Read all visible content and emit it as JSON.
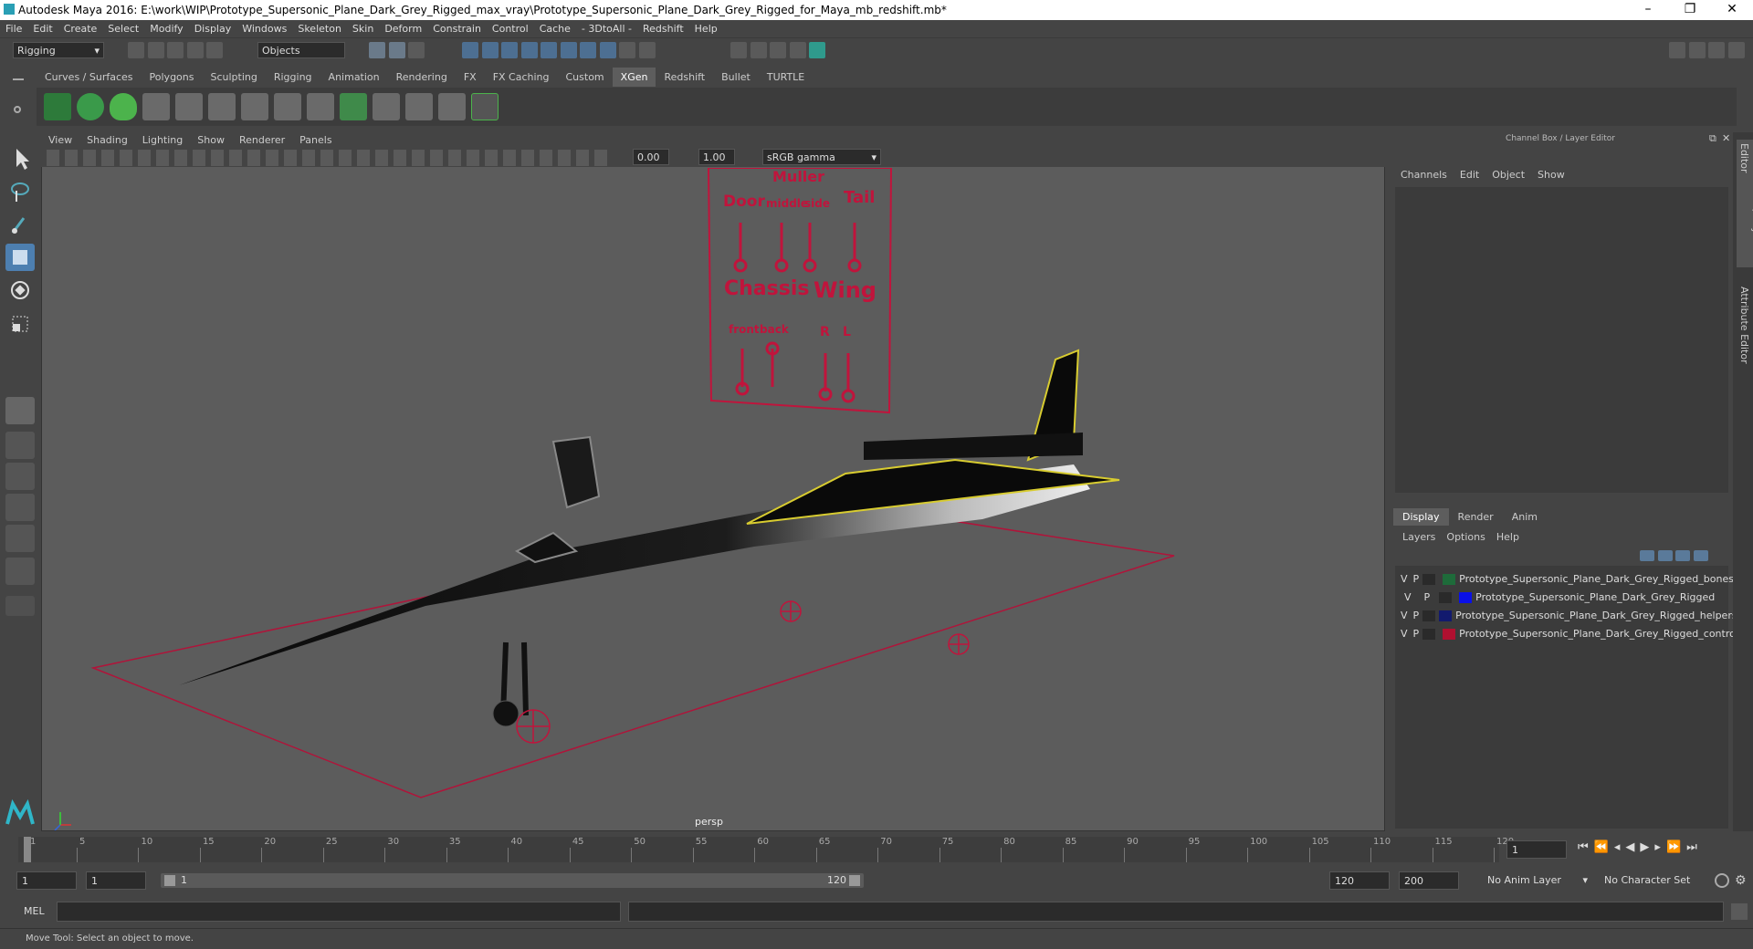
{
  "window": {
    "title": "Autodesk Maya 2016: E:\\work\\WIP\\Prototype_Supersonic_Plane_Dark_Grey_Rigged_max_vray\\Prototype_Supersonic_Plane_Dark_Grey_Rigged_for_Maya_mb_redshift.mb*"
  },
  "menu": [
    "File",
    "Edit",
    "Create",
    "Select",
    "Modify",
    "Display",
    "Windows",
    "Skeleton",
    "Skin",
    "Deform",
    "Constrain",
    "Control",
    "Cache",
    "- 3DtoAll -",
    "Redshift",
    "Help"
  ],
  "status": {
    "mode": "Rigging",
    "objects": "Objects"
  },
  "shelf_tabs": [
    "Curves / Surfaces",
    "Polygons",
    "Sculpting",
    "Rigging",
    "Animation",
    "Rendering",
    "FX",
    "FX Caching",
    "Custom",
    "XGen",
    "Redshift",
    "Bullet",
    "TURTLE"
  ],
  "shelf_active": "XGen",
  "viewport": {
    "menu": [
      "View",
      "Shading",
      "Lighting",
      "Show",
      "Renderer",
      "Panels"
    ],
    "exposure": "0.00",
    "gamma": "1.00",
    "colorspace": "sRGB gamma",
    "camera": "persp",
    "controls": {
      "muller": "Muller",
      "door": "Door",
      "middle": "middle",
      "side": "side",
      "tail": "Tail",
      "chassis": "Chassis",
      "wing": "Wing",
      "front": "front",
      "back": "back",
      "r": "R",
      "l": "L"
    }
  },
  "channel_box": {
    "title": "Channel Box / Layer Editor",
    "menu": [
      "Channels",
      "Edit",
      "Object",
      "Show"
    ]
  },
  "layer_editor": {
    "tabs": [
      "Display",
      "Render",
      "Anim"
    ],
    "active_tab": "Display",
    "menu": [
      "Layers",
      "Options",
      "Help"
    ],
    "layers": [
      {
        "v": "V",
        "p": "P",
        "color": "#1e6b3a",
        "name": "Prototype_Supersonic_Plane_Dark_Grey_Rigged_bones"
      },
      {
        "v": "V",
        "p": "P",
        "color": "#0a10e8",
        "name": "Prototype_Supersonic_Plane_Dark_Grey_Rigged"
      },
      {
        "v": "V",
        "p": "P",
        "color": "#121a6e",
        "name": "Prototype_Supersonic_Plane_Dark_Grey_Rigged_helpers"
      },
      {
        "v": "V",
        "p": "P",
        "color": "#b01030",
        "name": "Prototype_Supersonic_Plane_Dark_Grey_Rigged_controll"
      }
    ]
  },
  "side_tabs": [
    "Channel Box / Layer Editor",
    "Attribute Editor"
  ],
  "timeline": {
    "ticks": [
      "1",
      "5",
      "10",
      "15",
      "20",
      "25",
      "30",
      "35",
      "40",
      "45",
      "50",
      "55",
      "60",
      "65",
      "70",
      "75",
      "80",
      "85",
      "90",
      "95",
      "100",
      "105",
      "110",
      "115",
      "120"
    ],
    "current": "1"
  },
  "range": {
    "start": "1",
    "anim_start": "1",
    "slider_start": "1",
    "slider_end": "120",
    "end": "120",
    "anim_end": "200",
    "anim_layer": "No Anim Layer",
    "char_set": "No Character Set"
  },
  "mel": {
    "label": "MEL"
  },
  "help": {
    "text": "Move Tool: Select an object to move."
  }
}
